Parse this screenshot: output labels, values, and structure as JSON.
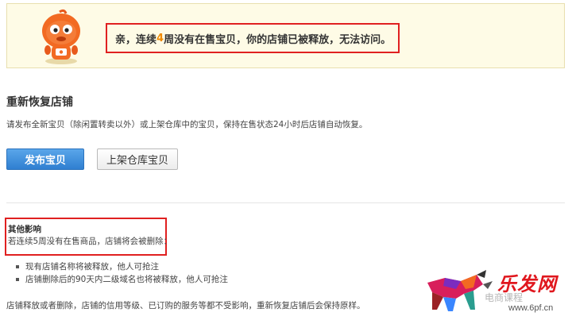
{
  "notice": {
    "text_before": "亲，连续",
    "weeks": "4",
    "text_after": "周没有在售宝贝，你的店铺已被释放，无法访问。",
    "mascot_icon": "orange-mascot-icon",
    "accent_color": "#e02020"
  },
  "restore": {
    "title": "重新恢复店铺",
    "description": "请发布全新宝贝（除闲置转卖以外）或上架仓库中的宝贝，保持在售状态24小时后店铺自动恢复。",
    "publish_button": "发布宝贝",
    "shelve_button": "上架仓库宝贝"
  },
  "impact": {
    "title": "其他影响",
    "text": "若连续5周没有在售商品，店铺将会被删除：",
    "bullets": [
      "现有店铺名称将被释放，他人可抢注",
      "店铺删除后的90天内二级域名也将被释放，他人可抢注"
    ],
    "footer": "店铺释放或者删除，店铺的信用等级、已订购的服务等都不受影响，重新恢复店铺后会保持原样。"
  },
  "watermark": {
    "brand": "乐发网",
    "faint_text": "电商课程",
    "url": "www.6pf.cn"
  }
}
